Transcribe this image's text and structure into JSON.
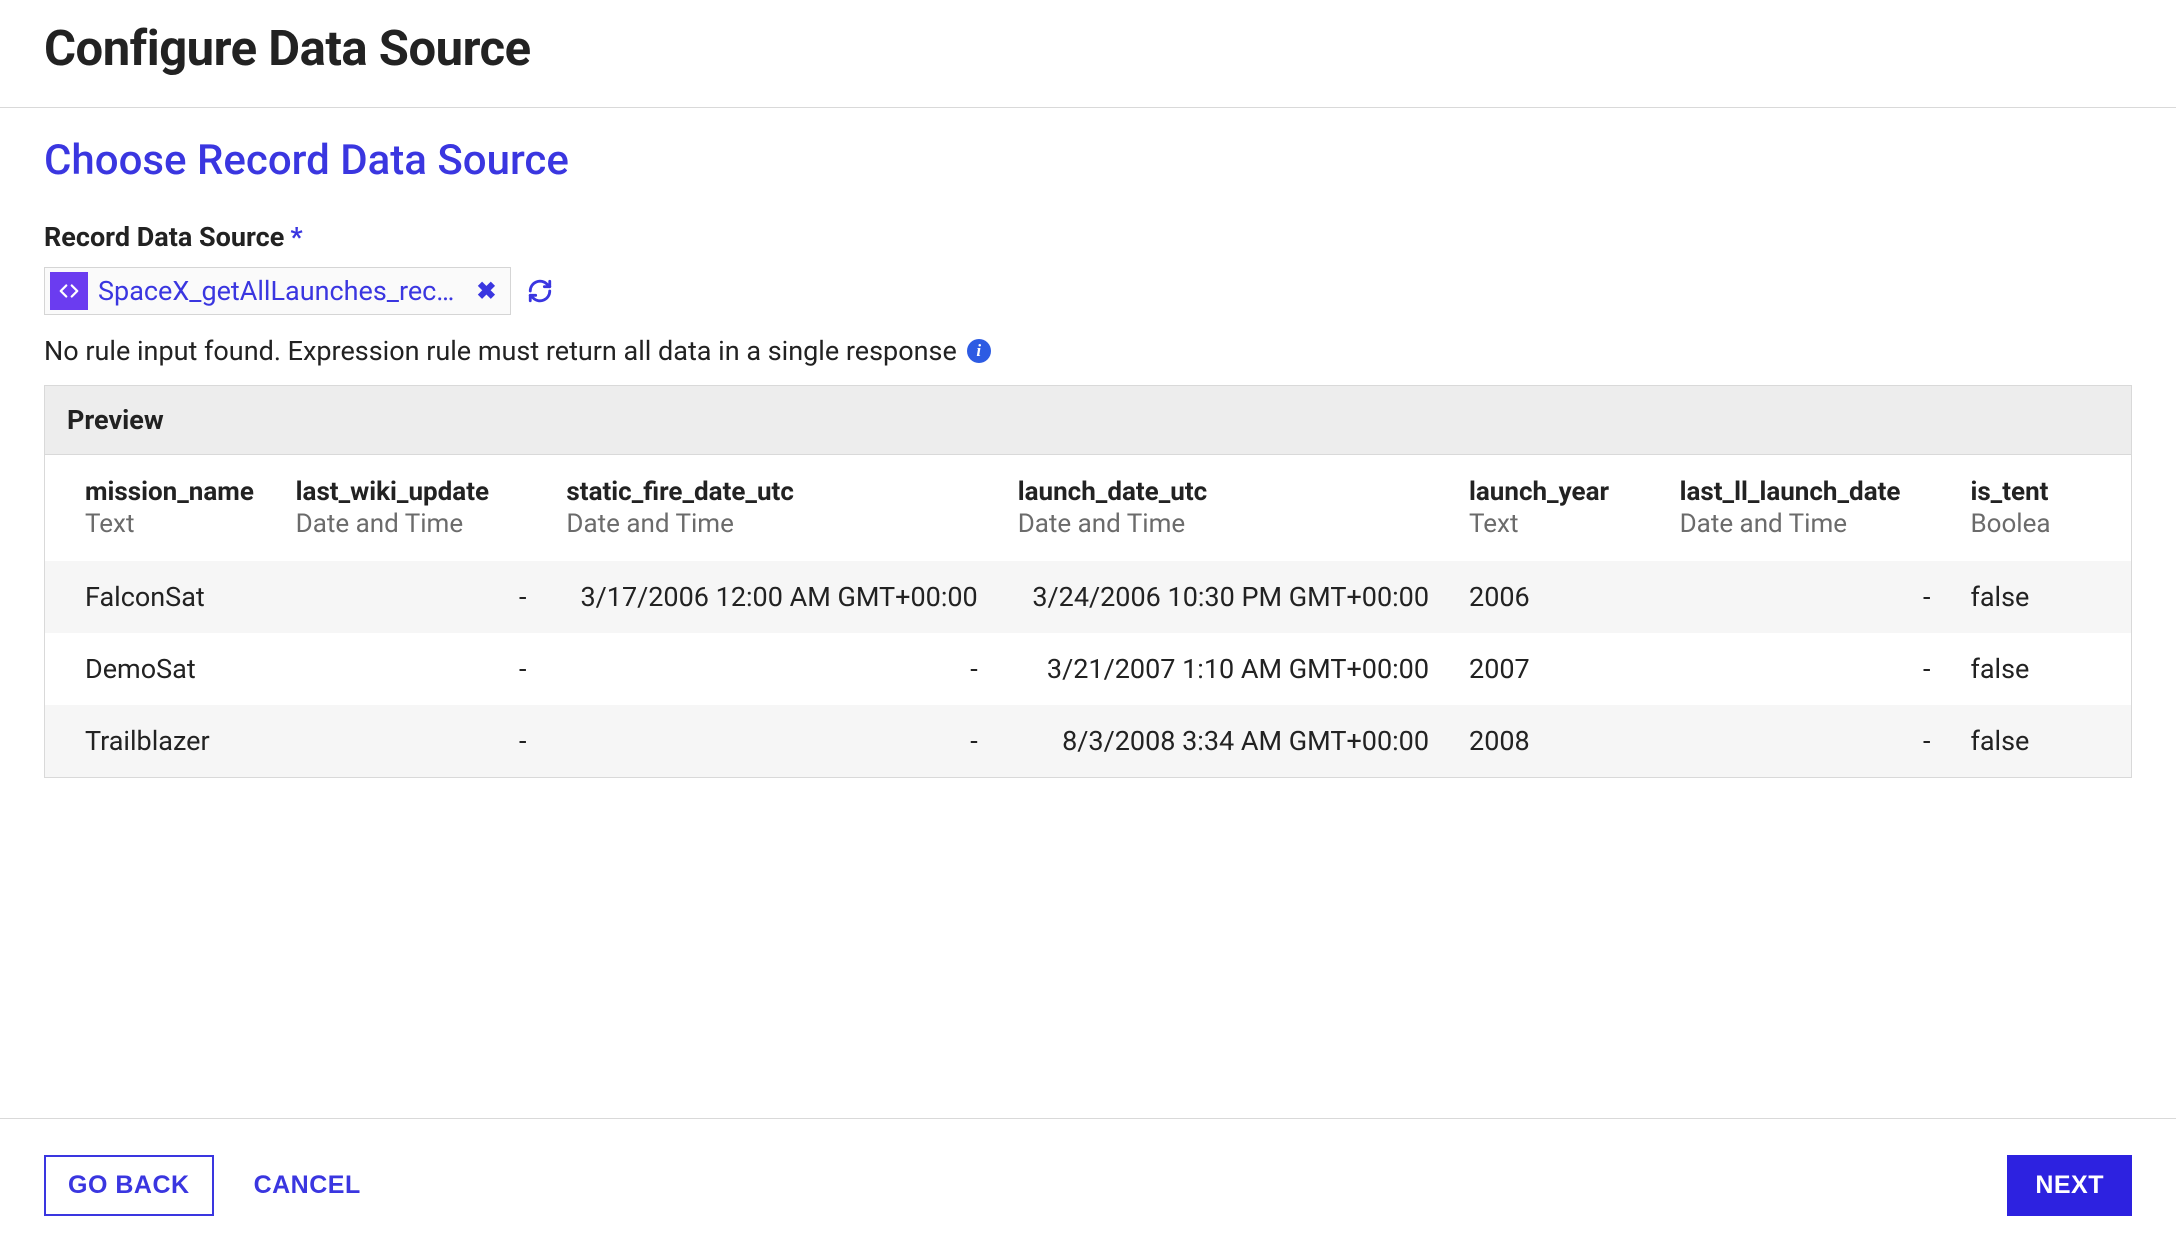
{
  "header": {
    "title": "Configure Data Source"
  },
  "section": {
    "title": "Choose Record Data Source"
  },
  "field": {
    "label": "Record Data Source",
    "required_marker": "*"
  },
  "source": {
    "chip_text": "SpaceX_getAllLaunches_rec…"
  },
  "info": {
    "text": "No rule input found. Expression rule must return all data in a single response"
  },
  "preview": {
    "label": "Preview",
    "columns": [
      {
        "name": "mission_name",
        "type": "Text"
      },
      {
        "name": "last_wiki_update",
        "type": "Date and Time"
      },
      {
        "name": "static_fire_date_utc",
        "type": "Date and Time"
      },
      {
        "name": "launch_date_utc",
        "type": "Date and Time"
      },
      {
        "name": "launch_year",
        "type": "Text"
      },
      {
        "name": "last_ll_launch_date",
        "type": "Date and Time"
      },
      {
        "name": "is_tent",
        "type": "Boolea"
      }
    ],
    "rows": [
      {
        "c0": "FalconSat",
        "c1": "-",
        "c2": "3/17/2006 12:00 AM GMT+00:00",
        "c3": "3/24/2006 10:30 PM GMT+00:00",
        "c4": "2006",
        "c5": "-",
        "c6": "false"
      },
      {
        "c0": "DemoSat",
        "c1": "-",
        "c2": "-",
        "c3": "3/21/2007 1:10 AM GMT+00:00",
        "c4": "2007",
        "c5": "-",
        "c6": "false"
      },
      {
        "c0": "Trailblazer",
        "c1": "-",
        "c2": "-",
        "c3": "8/3/2008 3:34 AM GMT+00:00",
        "c4": "2008",
        "c5": "-",
        "c6": "false"
      }
    ]
  },
  "footer": {
    "go_back": "GO BACK",
    "cancel": "CANCEL",
    "next": "NEXT"
  }
}
